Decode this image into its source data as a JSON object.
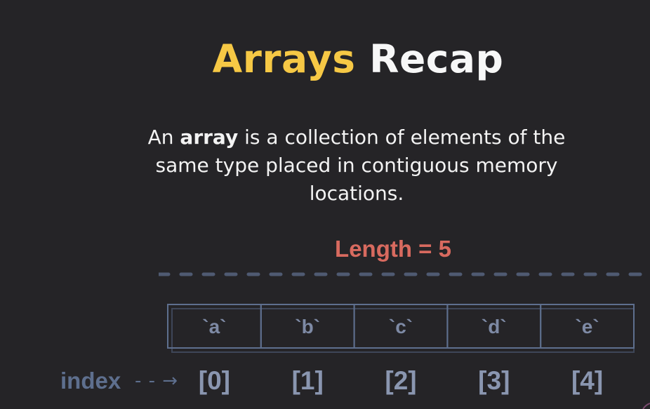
{
  "title": {
    "accent": "Arrays",
    "rest": "Recap"
  },
  "description": {
    "before": "An ",
    "bold": "array",
    "after": " is a collection of elements of the same type placed in contiguous memory locations."
  },
  "length_label": "Length = 5",
  "index": {
    "label": "index",
    "arrow": "- - →"
  },
  "elements": [
    "`a`",
    "`b`",
    "`c`",
    "`d`",
    "`e`"
  ],
  "indices": [
    "[0]",
    "[1]",
    "[2]",
    "[3]",
    "[4]"
  ],
  "colors": {
    "background": "#252427",
    "title_accent": "#f6c845",
    "length": "#d86a5f",
    "array_outline": "#5e6f8e",
    "index_text": "#8a96b0"
  }
}
